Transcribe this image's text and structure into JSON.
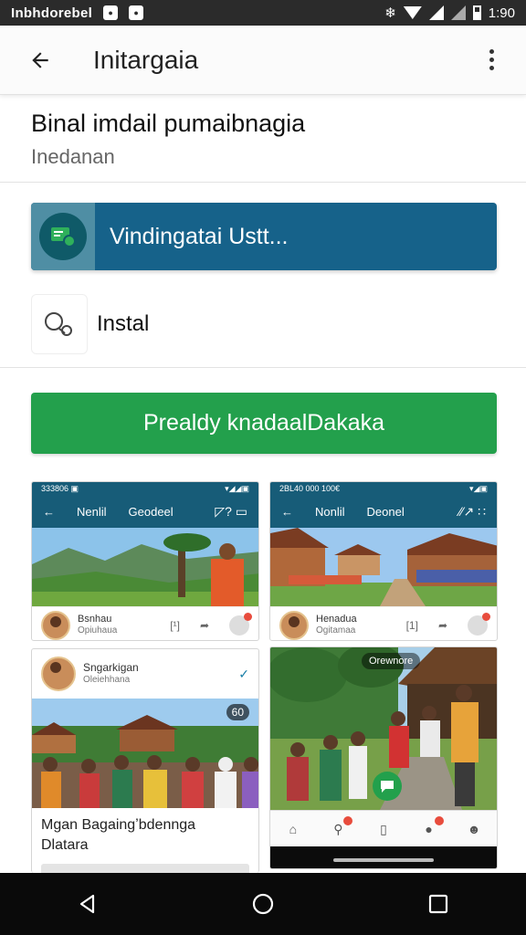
{
  "status_bar": {
    "carrier": "Inbhdorebel",
    "time": "1:90"
  },
  "app_bar": {
    "title": "Initargaia"
  },
  "header": {
    "title": "Binal imdail pumaibnagia",
    "subtitle": "Inedanan"
  },
  "actions": {
    "blue_label": "Vindingatai Ustt...",
    "install_label": "Instal",
    "green_label": "Prealdy knadaalDakaka"
  },
  "screenshots": {
    "card1": {
      "status_text": "333806 ▣",
      "tab1": "Nenlil",
      "tab2": "Geodeel",
      "right": "◸? ▭",
      "post_name": "Bsnhau",
      "post_sub": "Opiuhaua",
      "count": "[¹]"
    },
    "card2": {
      "status_text": "2BL40 000 100€",
      "tab1": "Nonlil",
      "tab2": "Deonel",
      "right": "⁄⁄↗ ∷",
      "post_name": "Henadua",
      "post_sub": "Ogitamaa",
      "count": "[1]"
    },
    "card3": {
      "post_name": "Sngarkigan",
      "post_sub": "Oleiehhana",
      "overlay_label": "60",
      "caption_line1": "Mgan Bagaingʼbdennga",
      "caption_line2": "Dlatara"
    },
    "card4": {
      "overlay_label": "Orewnore"
    }
  },
  "colors": {
    "status_bar": "#2b2b2b",
    "blue_action": "#16628a",
    "green_button": "#23a04c",
    "mini_app_bar": "#175c78",
    "system_nav": "#0a0a0a"
  }
}
